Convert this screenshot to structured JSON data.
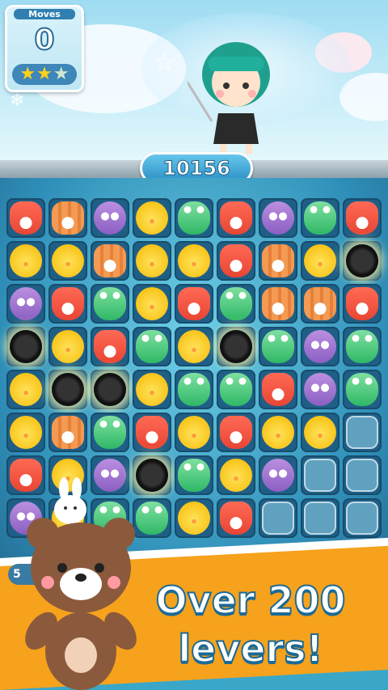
{
  "hud": {
    "moves_label": "Moves",
    "moves_value": "0",
    "stars_earned": 2,
    "stars_total": 3
  },
  "score": "10156",
  "side_badge": "5",
  "headline": {
    "line1": "Over 200",
    "line2": "levers!"
  },
  "colors": {
    "accent": "#2f7fb0",
    "banner": "#f6a21c",
    "text_stroke": "#1b6a96"
  },
  "board": {
    "rows": [
      [
        "fox",
        "cat",
        "owl",
        "chick",
        "frog",
        "fox",
        "owl",
        "frog",
        "fox"
      ],
      [
        "chick",
        "chick",
        "cat",
        "chick",
        "chick",
        "fox",
        "cat",
        "chick",
        "bomb"
      ],
      [
        "owl",
        "fox",
        "frog",
        "chick",
        "fox",
        "frog",
        "cat",
        "cat",
        "fox"
      ],
      [
        "bomb",
        "chick",
        "fox",
        "frog",
        "chick",
        "bomb",
        "frog",
        "owl",
        "frog"
      ],
      [
        "chick",
        "bomb",
        "bomb",
        "chick",
        "frog",
        "frog",
        "fox",
        "owl",
        "frog"
      ],
      [
        "chick",
        "cat",
        "frog",
        "fox",
        "chick",
        "fox",
        "chick",
        "chick",
        "jelly"
      ],
      [
        "fox",
        "chick",
        "owl",
        "bomb",
        "frog",
        "chick",
        "owl",
        "jelly",
        "jelly"
      ],
      [
        "owl",
        "chick",
        "frog",
        "frog",
        "chick",
        "fox",
        "jelly",
        "jelly",
        "jelly"
      ]
    ]
  }
}
